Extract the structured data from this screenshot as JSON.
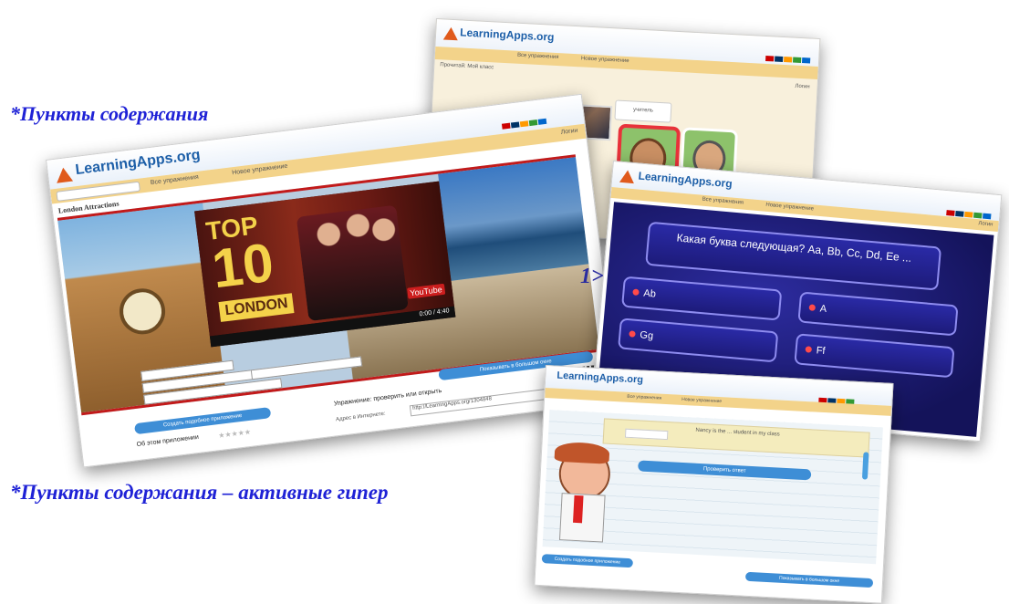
{
  "captions": {
    "top": "*Пункты содержания",
    "bottom": "*Пункты содержания – активные гипер",
    "mid_fragment": "1>"
  },
  "colors": {
    "caption": "#1f22d6",
    "logo": "#1d5fa8",
    "quiz_bg": "#1b1a75",
    "accent_bar": "#f3d38a"
  },
  "windows": {
    "main": {
      "logo": "LearningApps.org",
      "nav_all": "Все упражнения",
      "nav_new": "Новое упражнение",
      "login": "Логин",
      "page_title": "London Attractions",
      "video": {
        "top_word": "TOP",
        "number": "10",
        "city": "LONDON",
        "brand": "YouTube",
        "time": "0:00 / 4:40"
      },
      "fullscreen_btn": "Показывать в большом окне",
      "details_btn": "Создать подобное приложение",
      "rating_label": "Об этом приложении",
      "embed_title": "Упражнение: проверить или открыть",
      "link_label": "Адрес в Интернете:",
      "link_value": "http://LearningApps.org/1304848"
    },
    "top_right": {
      "logo": "LearningApps.org",
      "nav_all": "Все упражнения",
      "nav_new": "Новое упражнение",
      "login": "Логин",
      "heading": "Прочитай: Мой класс",
      "card_label": "учитель"
    },
    "quiz": {
      "logo": "LearningApps.org",
      "nav_all": "Все упражнения",
      "nav_new": "Новое упражнение",
      "login": "Логин",
      "question": "Какая буква следующая? Aa, Bb, Cc, Dd, Ee ...",
      "answers": [
        "Ab",
        "А",
        "Gg",
        "Ff"
      ]
    },
    "bottom": {
      "logo": "LearningApps.org",
      "nav_all": "Все упражнения",
      "nav_new": "Новое упражнение",
      "sentence": "Nancy is the ... student in my class",
      "check_btn": "Проверить ответ",
      "pill_left": "Создать подобное приложение",
      "pill_right": "Показывать в большом окне"
    }
  }
}
